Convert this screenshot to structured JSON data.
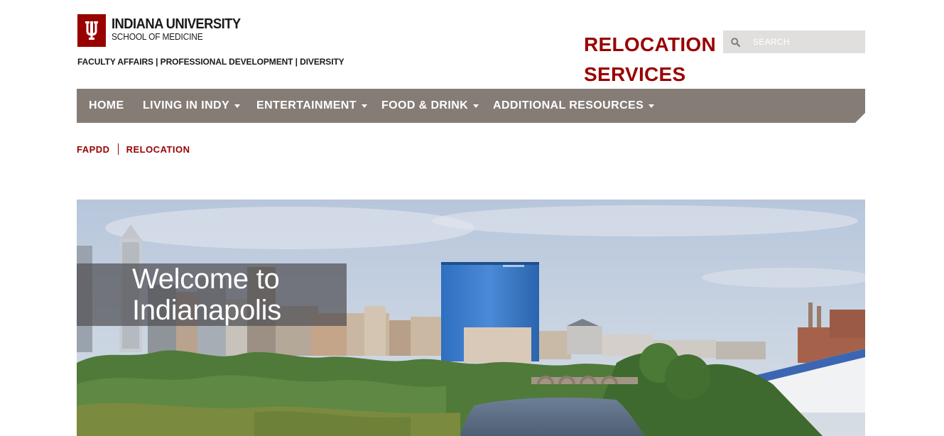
{
  "header": {
    "logo_university": "INDIANA UNIVERSITY",
    "logo_school": "SCHOOL OF MEDICINE",
    "tagline": "FACULTY AFFAIRS | PROFESSIONAL DEVELOPMENT | DIVERSITY",
    "site_title": "RELOCATION SERVICES",
    "brand_color": "#990000"
  },
  "search": {
    "placeholder": "SEARCH",
    "icon": "search-icon"
  },
  "nav": {
    "items": [
      {
        "label": "HOME",
        "has_dropdown": false
      },
      {
        "label": "LIVING IN INDY",
        "has_dropdown": true
      },
      {
        "label": "ENTERTAINMENT",
        "has_dropdown": true
      },
      {
        "label": "FOOD & DRINK",
        "has_dropdown": true
      },
      {
        "label": "ADDITIONAL RESOURCES",
        "has_dropdown": true
      }
    ],
    "background": "#857c76"
  },
  "breadcrumb": {
    "items": [
      "FAPDD",
      "RELOCATION"
    ]
  },
  "hero": {
    "welcome_line1": "Welcome to",
    "welcome_line2": "Indianapolis"
  }
}
